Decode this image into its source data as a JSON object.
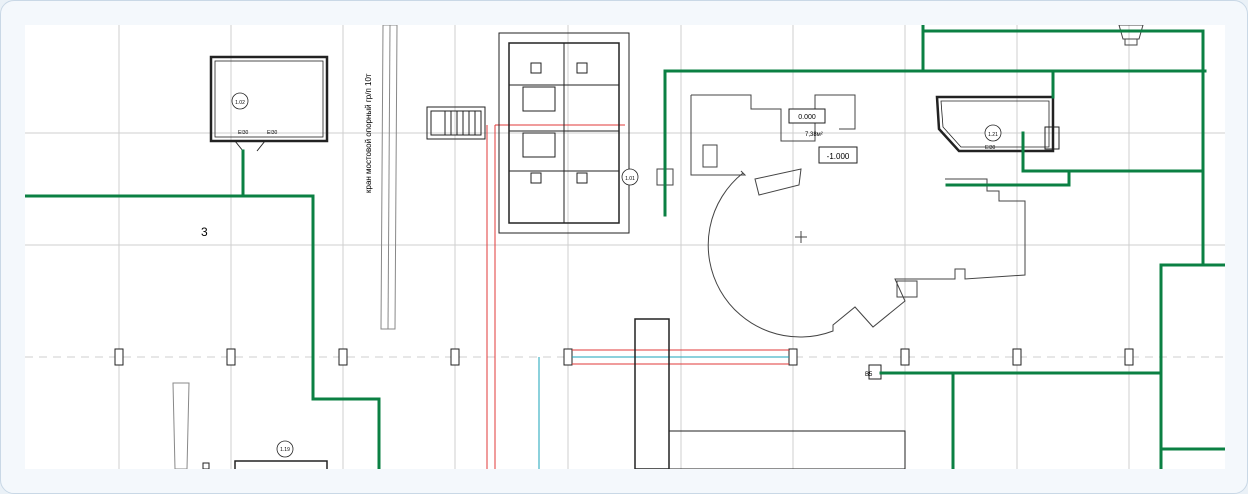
{
  "drawing": {
    "zone_label": "3",
    "crane_label": "кран мостовой опорный гр/п 10т",
    "rooms": [
      {
        "id": "room-1-02",
        "number": "1.02",
        "door_left": "EI30",
        "door_right": "EI30"
      },
      {
        "id": "room-1-01",
        "number": "1.01"
      },
      {
        "id": "room-1-21",
        "number": "1.21",
        "door": "EI30"
      },
      {
        "id": "room-1-19",
        "number": "1.19"
      }
    ],
    "levels": {
      "zero": "0.000",
      "minus": "-1.000"
    },
    "area_note": "7,38м²",
    "outlet_mark": "В5",
    "colors": {
      "fire_wall": "#0b8043",
      "gridline": "#c8c8c8",
      "duct_red": "#e03a3a",
      "duct_cyan": "#1aa3b8",
      "outline": "#222222"
    }
  }
}
